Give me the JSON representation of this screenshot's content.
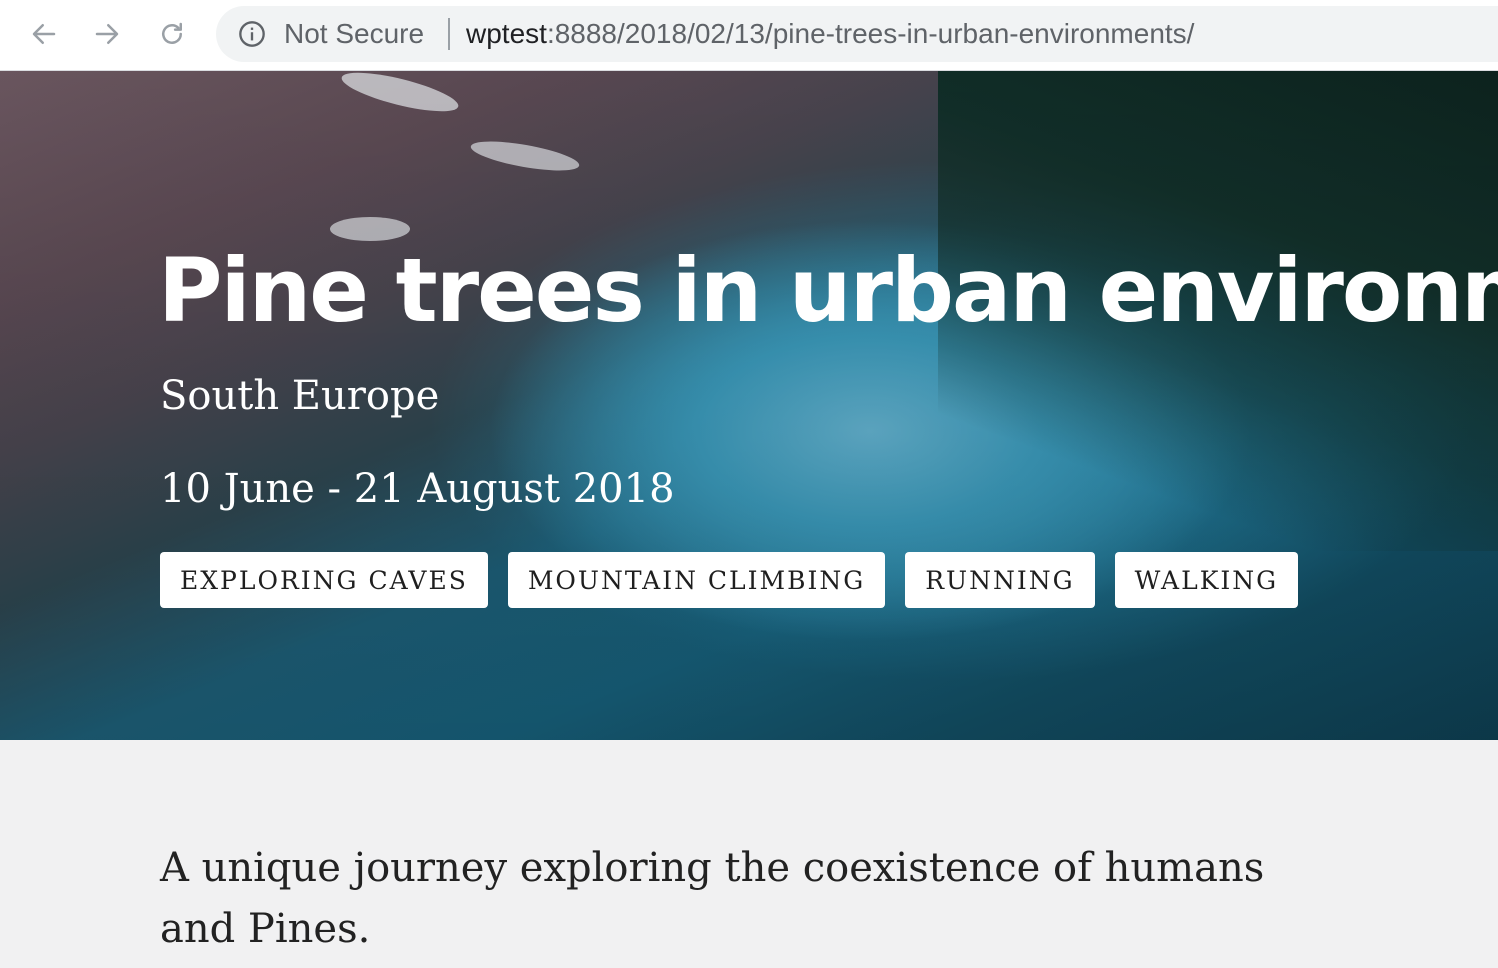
{
  "browser": {
    "security_label": "Not Secure",
    "url_host": "wptest",
    "url_path": ":8888/2018/02/13/pine-trees-in-urban-environments/"
  },
  "hero": {
    "title": "Pine trees in urban environments",
    "location": "South Europe",
    "dates": "10 June - 21 August 2018",
    "tags": [
      "EXPLORING CAVES",
      "MOUNTAIN CLIMBING",
      "RUNNING",
      "WALKING"
    ]
  },
  "content": {
    "lead": "A unique journey exploring the coexistence of humans and Pines."
  }
}
